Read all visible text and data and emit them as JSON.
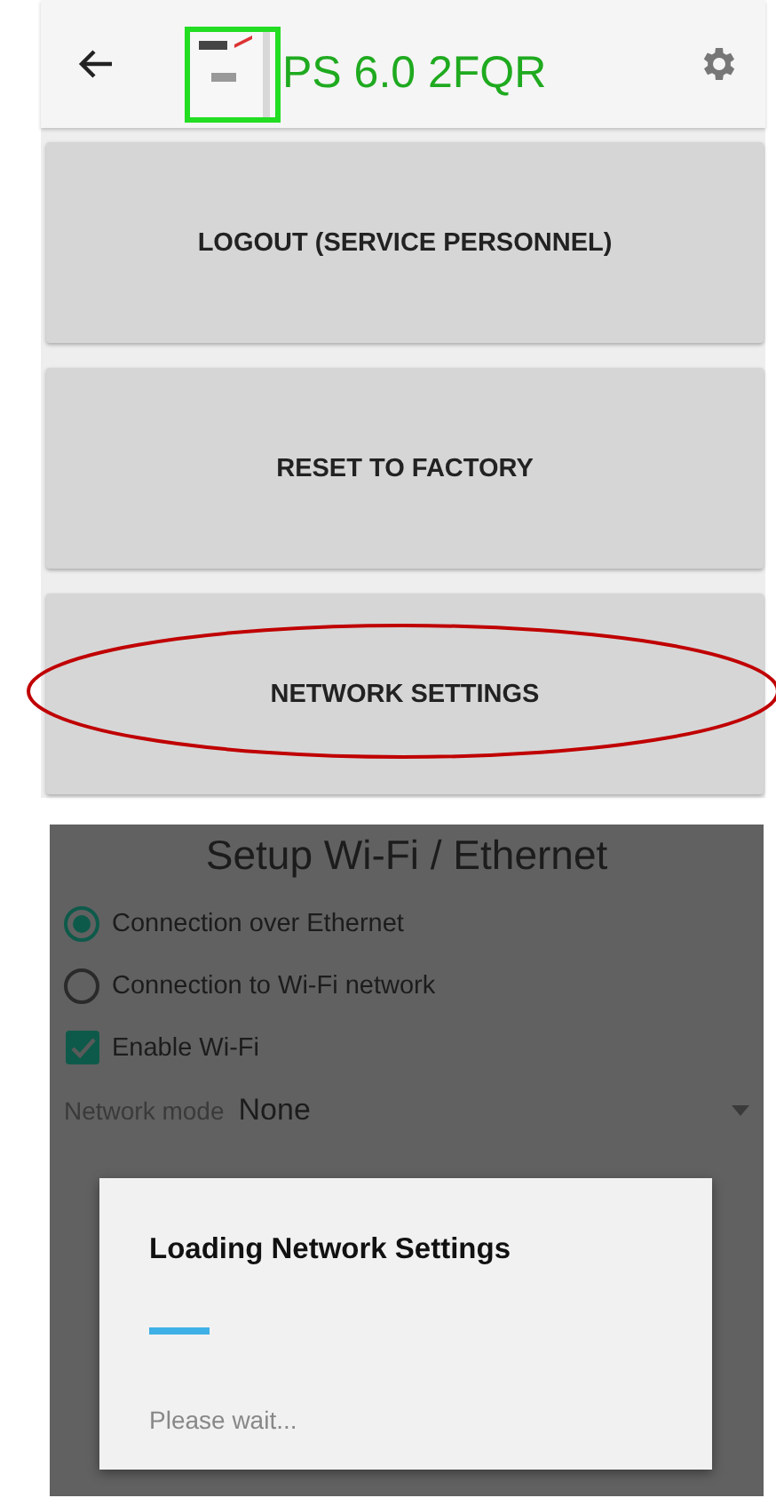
{
  "header": {
    "title": "PS 6.0 2FQR"
  },
  "menu_buttons": [
    {
      "label": "LOGOUT (SERVICE PERSONNEL)",
      "highlighted": false
    },
    {
      "label": "RESET TO FACTORY",
      "highlighted": false
    },
    {
      "label": "NETWORK SETTINGS",
      "highlighted": true
    }
  ],
  "setup": {
    "title": "Setup Wi-Fi / Ethernet",
    "connection_options": [
      {
        "label": "Connection over Ethernet",
        "selected": true
      },
      {
        "label": "Connection to Wi-Fi network",
        "selected": false
      }
    ],
    "enable_wifi": {
      "label": "Enable Wi-Fi",
      "checked": true
    },
    "network_mode": {
      "label": "Network mode",
      "value": "None"
    }
  },
  "dialog": {
    "title": "Loading Network Settings",
    "message": "Please wait..."
  }
}
